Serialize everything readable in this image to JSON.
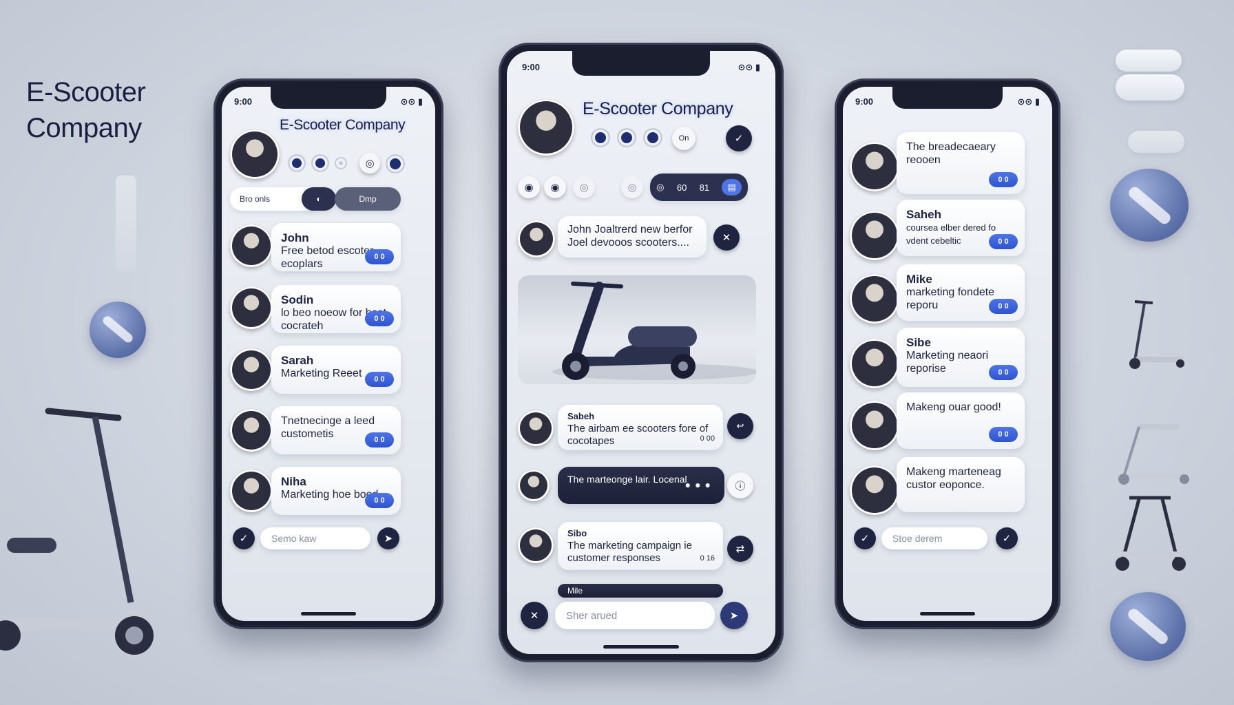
{
  "brand": {
    "line1": "E-Scooter",
    "line2": "Company"
  },
  "phones": {
    "left": {
      "status": "9:00",
      "title": "E-Scooter Company",
      "filter_left": "Bro onls",
      "filter_right": "Dmp",
      "messages": [
        {
          "name": "John",
          "text": "Free betod escoter ecoplars",
          "badge": "0 0"
        },
        {
          "name": "Sodin",
          "text": "lo beo noeow for best cocrateh",
          "badge": "0 0"
        },
        {
          "name": "Sarah",
          "text": "Marketing Reeet",
          "badge": "0 0"
        },
        {
          "name": "",
          "text": "Tnetnecinge a leed custometis",
          "badge": "0 0"
        },
        {
          "name": "Niha",
          "text": "Marketing hoe bood",
          "badge": "0 0"
        }
      ],
      "input_placeholder": "Semo kaw"
    },
    "center": {
      "status": "9:00",
      "title": "E-Scooter Company",
      "tabs": [
        "60",
        "81"
      ],
      "top_message": "John Joaltrerd new berfor Joel devooos scooters....",
      "messages": [
        {
          "name": "Sabeh",
          "text": "The airbam ee scooters fore of cocotapes",
          "meta": "0 00",
          "dark": false
        },
        {
          "name": "",
          "text": "The marteonge lair. Locenal",
          "meta": "",
          "dark": true
        },
        {
          "name": "Sibo",
          "text": "The marketing campaign ie customer responses",
          "meta": "0 16",
          "dark": false
        },
        {
          "name": "Mile",
          "text": "",
          "meta": "",
          "dark": true
        }
      ],
      "input_placeholder": "Sher arued"
    },
    "right": {
      "status": "9:00",
      "messages": [
        {
          "name": "",
          "text": "The breadecaeary reooen",
          "badge": "0 0"
        },
        {
          "name": "Saheh",
          "text": "coursea elber dered fo vdent cebeltic",
          "badge": "0 0"
        },
        {
          "name": "Mike",
          "text": "marketing fondete reporu",
          "badge": "0 0"
        },
        {
          "name": "Sibe",
          "text": "Marketing neaori reporise",
          "badge": "0 0"
        },
        {
          "name": "",
          "text": "Makeng ouar good!",
          "badge": "0 0"
        },
        {
          "name": "",
          "text": "Makeng marteneag custor eoponce.",
          "badge": ""
        }
      ],
      "input_placeholder": "Stoe derem"
    }
  },
  "icons": {
    "send": "send-icon",
    "check": "check-icon",
    "close": "close-icon"
  },
  "colors": {
    "accent": "#2e55d0",
    "dark": "#1f2440",
    "bg": "#cfd5df"
  }
}
